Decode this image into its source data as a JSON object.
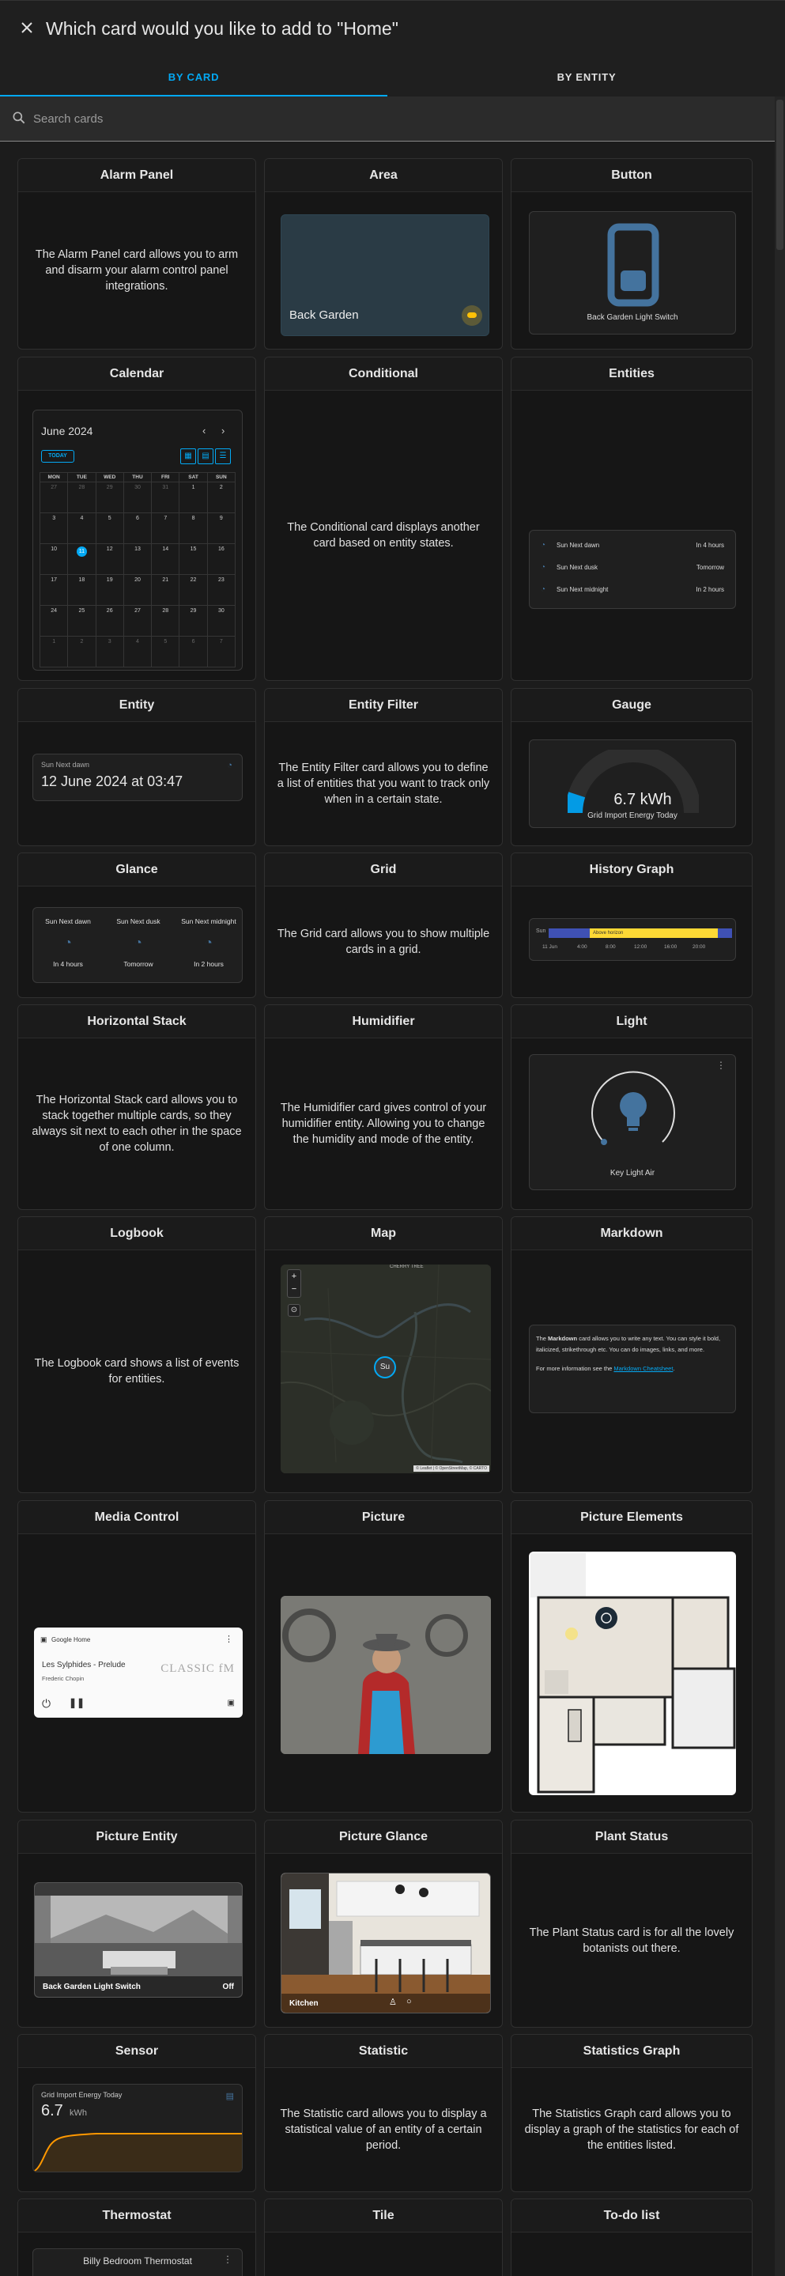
{
  "dialog": {
    "title": "Which card would you like to add to \"Home\"",
    "tabs": [
      {
        "label": "BY CARD"
      },
      {
        "label": "BY ENTITY"
      }
    ],
    "search_placeholder": "Search cards"
  },
  "cards": {
    "alarm_panel": {
      "title": "Alarm Panel",
      "desc": "The Alarm Panel card allows you to arm and disarm your alarm control panel integrations."
    },
    "area": {
      "title": "Area",
      "label": "Back Garden"
    },
    "button": {
      "title": "Button",
      "label": "Back Garden Light Switch"
    },
    "calendar": {
      "title": "Calendar",
      "month": "June 2024",
      "today": "TODAY",
      "weekdays": [
        "MON",
        "TUE",
        "WED",
        "THU",
        "FRI",
        "SAT",
        "SUN"
      ],
      "weeks": [
        [
          "27",
          "28",
          "29",
          "30",
          "31",
          "1",
          "2"
        ],
        [
          "3",
          "4",
          "5",
          "6",
          "7",
          "8",
          "9"
        ],
        [
          "10",
          "11",
          "12",
          "13",
          "14",
          "15",
          "16"
        ],
        [
          "17",
          "18",
          "19",
          "20",
          "21",
          "22",
          "23"
        ],
        [
          "24",
          "25",
          "26",
          "27",
          "28",
          "29",
          "30"
        ],
        [
          "1",
          "2",
          "3",
          "4",
          "5",
          "6",
          "7"
        ]
      ]
    },
    "conditional": {
      "title": "Conditional",
      "desc": "The Conditional card displays another card based on entity states."
    },
    "entities": {
      "title": "Entities",
      "rows": [
        {
          "name": "Sun Next dawn",
          "state": "In 4 hours"
        },
        {
          "name": "Sun Next dusk",
          "state": "Tomorrow"
        },
        {
          "name": "Sun Next midnight",
          "state": "In 2 hours"
        }
      ]
    },
    "entity": {
      "title": "Entity",
      "name": "Sun Next dawn",
      "value": "12 June 2024 at 03:47"
    },
    "entity_filter": {
      "title": "Entity Filter",
      "desc": "The Entity Filter card allows you to define a list of entities that you want to track only when in a certain state."
    },
    "gauge": {
      "title": "Gauge",
      "value": "6.7 kWh",
      "label": "Grid Import Energy Today",
      "level": 0.1
    },
    "glance": {
      "title": "Glance",
      "items": [
        {
          "name": "Sun Next dawn",
          "state": "In 4 hours"
        },
        {
          "name": "Sun Next dusk",
          "state": "Tomorrow"
        },
        {
          "name": "Sun Next midnight",
          "state": "In 2 hours"
        }
      ]
    },
    "grid": {
      "title": "Grid",
      "desc": "The Grid card allows you to show multiple cards in a grid."
    },
    "history_graph": {
      "title": "History Graph",
      "row_label": "Sun",
      "state_label": "Above horizon",
      "axis": [
        "11 Jun",
        "4:00",
        "8:00",
        "12:00",
        "16:00",
        "20:00"
      ]
    },
    "horizontal_stack": {
      "title": "Horizontal Stack",
      "desc": "The Horizontal Stack card allows you to stack together multiple cards, so they always sit next to each other in the space of one column."
    },
    "humidifier": {
      "title": "Humidifier",
      "desc": "The Humidifier card gives control of your humidifier entity. Allowing you to change the humidity and mode of the entity."
    },
    "light": {
      "title": "Light",
      "label": "Key Light Air"
    },
    "logbook": {
      "title": "Logbook",
      "desc": "The Logbook card shows a list of events for entities."
    },
    "map": {
      "title": "Map",
      "place": "CHERRY TREE",
      "marker": "Su",
      "attribution": "© Leaflet | © OpenStreetMap, © CARTO"
    },
    "markdown": {
      "title": "Markdown",
      "p1_a": "The ",
      "p1_b": "Markdown",
      "p1_c": " card allows you to write any text. You can style it bold, italicized, strikethrough etc. You can do images, links, and more.",
      "p2_a": "For more information see the ",
      "p2_link": "Markdown Cheatsheet",
      "p2_b": "."
    },
    "media_control": {
      "title": "Media Control",
      "device": "Google Home",
      "track": "Les Sylphides - Prelude",
      "artist": "Frederic Chopin",
      "logo": "CLASSIC fM"
    },
    "picture": {
      "title": "Picture"
    },
    "picture_elements": {
      "title": "Picture Elements"
    },
    "picture_entity": {
      "title": "Picture Entity",
      "label": "Back Garden Light Switch",
      "state": "Off"
    },
    "picture_glance": {
      "title": "Picture Glance",
      "label": "Kitchen"
    },
    "plant_status": {
      "title": "Plant Status",
      "desc": "The Plant Status card is for all the lovely botanists out there."
    },
    "sensor": {
      "title": "Sensor",
      "name": "Grid Import Energy Today",
      "value": "6.7",
      "unit": "kWh"
    },
    "statistic": {
      "title": "Statistic",
      "desc": "The Statistic card allows you to display a statistical value of an entity of a certain period."
    },
    "statistics_graph": {
      "title": "Statistics Graph",
      "desc": "The Statistics Graph card allows you to display a graph of the statistics for each of the entities listed."
    },
    "thermostat": {
      "title": "Thermostat",
      "label": "Billy Bedroom Thermostat"
    },
    "tile": {
      "title": "Tile"
    },
    "todo_list": {
      "title": "To-do list"
    }
  },
  "colors": {
    "accent": "#03a9f4",
    "background": "#1c1c1c",
    "card": "#161616",
    "warning": "#ffc107"
  }
}
